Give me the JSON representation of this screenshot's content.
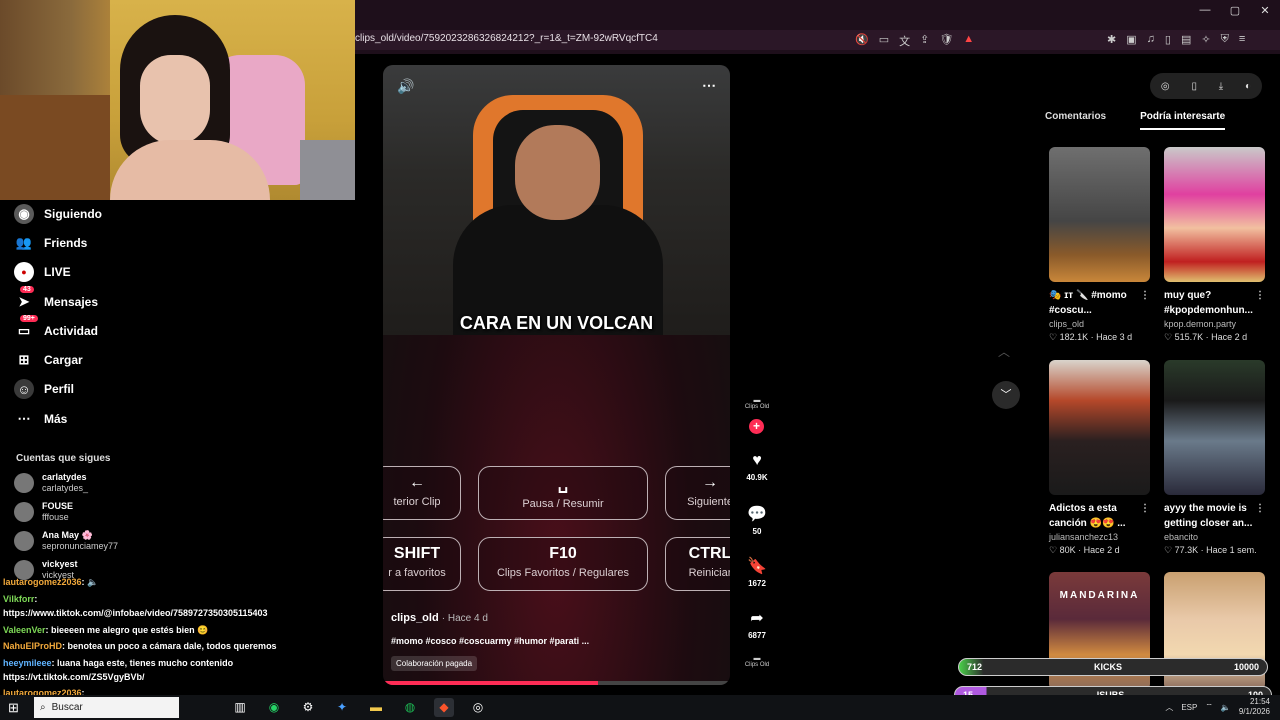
{
  "browser": {
    "url": "clips_old/video/7592023286326824212?_r=1&_t=ZM-92wRVqcfTC4",
    "window_controls": [
      "—",
      "▢",
      "✕"
    ]
  },
  "sidebar": {
    "items": [
      {
        "label": "Siguiendo",
        "icon": "following-icon",
        "badge": ""
      },
      {
        "label": "Friends",
        "icon": "friends-icon",
        "badge": ""
      },
      {
        "label": "LIVE",
        "icon": "live-icon",
        "badge": ""
      },
      {
        "label": "Mensajes",
        "icon": "messages-icon",
        "badge": "43"
      },
      {
        "label": "Actividad",
        "icon": "activity-icon",
        "badge": "99+"
      },
      {
        "label": "Cargar",
        "icon": "upload-icon",
        "badge": ""
      },
      {
        "label": "Perfil",
        "icon": "profile-icon",
        "badge": ""
      },
      {
        "label": "Más",
        "icon": "more-icon",
        "badge": ""
      }
    ],
    "following_heading": "Cuentas que sigues",
    "accounts": [
      {
        "name": "carlatydes",
        "handle": "carlatydes_"
      },
      {
        "name": "FOUSE",
        "handle": "fffouse"
      },
      {
        "name": "Ana May 🌸",
        "handle": "sepronunciamey77"
      },
      {
        "name": "vickyest",
        "handle": "vickyest"
      }
    ]
  },
  "chat": [
    {
      "user": "lautarogomez2036",
      "text": ": 🔈",
      "color": "orange"
    },
    {
      "user": "Vilkforr",
      "text": ":",
      "color": "green"
    },
    {
      "user": "",
      "text": "https://www.tiktok.com/@infobae/video/7589727350305115403",
      "color": "orange"
    },
    {
      "user": "ValeenVer",
      "text": ": bieeeen me alegro que estés bien 😊",
      "color": "green"
    },
    {
      "user": "NahuElProHD",
      "text": ": benotea un poco a cámara dale, todos queremos",
      "color": "orange"
    },
    {
      "user": "heeymileee",
      "text": ": luana haga este, tienes mucho contenido",
      "color": "blue"
    },
    {
      "user": "",
      "text": "https://vt.tiktok.com/ZS5VgyBVb/",
      "color": "orange"
    },
    {
      "user": "lautarogomez2036",
      "text": ":",
      "color": "orange"
    }
  ],
  "video": {
    "caption": "CARA EN UN VOLCAN",
    "keys": [
      {
        "big": "←",
        "small": "terior Clip"
      },
      {
        "big": "␣",
        "small": "Pausa / Resumir"
      },
      {
        "big": "→",
        "small": "Siguiente"
      },
      {
        "big": "SHIFT",
        "small": "r a favoritos"
      },
      {
        "big": "F10",
        "small": "Clips Favoritos / Regulares"
      },
      {
        "big": "CTRL",
        "small": "Reiniciar"
      }
    ],
    "author": "clips_old",
    "time": "· Hace 4 d",
    "tags": "#momo #cosco #coscuarmy #humor #parati ...",
    "paid_label": "Colaboración pagada",
    "progress": 0.62
  },
  "rail": {
    "avatar_label": "Clips Old",
    "likes": "40.9K",
    "comments": "50",
    "saves": "1672",
    "shares": "6877",
    "music_label": "Clips Old"
  },
  "right_panel": {
    "tabs": [
      "Comentarios",
      "Podría interesarte"
    ],
    "cards": [
      {
        "title": "🎭 ɪᴛ 🔪 #momo #coscu...",
        "author": "clips_old",
        "likes": "182.1K",
        "time": "Hace 3 d"
      },
      {
        "title": "muy que? #kpopdemonhun...",
        "author": "kpop.demon.party",
        "likes": "515.7K",
        "time": "Hace 2 d"
      },
      {
        "title": "Adictos a esta canción 😍😍 ...",
        "author": "juliansanchezc13",
        "likes": "80K",
        "time": "Hace 2 d"
      },
      {
        "title": "ayyy the movie is getting closer an...",
        "author": "ebancito",
        "likes": "77.3K",
        "time": "Hace 1 sem."
      },
      {
        "title": "MANDARINA",
        "author": "",
        "likes": "",
        "time": ""
      },
      {
        "title": "",
        "author": "",
        "likes": "",
        "time": ""
      }
    ]
  },
  "overlay": {
    "bar1_left": "712",
    "bar1_mid": "KICKS",
    "bar1_right": "10000",
    "bar2_left": "15",
    "bar2_mid": "ISUBS",
    "bar2_right": "100"
  },
  "taskbar": {
    "search_placeholder": "Buscar",
    "lang": "ESP",
    "time": "21:54",
    "date": "9/1/2026"
  }
}
